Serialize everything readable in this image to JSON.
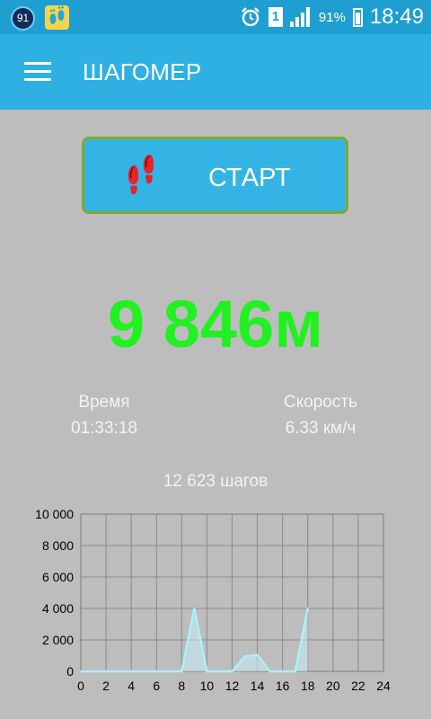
{
  "status_bar": {
    "notification_badge": "91",
    "sim_slot": "1",
    "battery_percent": "91%",
    "time": "18:49",
    "icons": [
      "notification-badge-icon",
      "pedometer-app-icon",
      "alarm-icon",
      "sim-icon",
      "signal-icon",
      "battery-icon"
    ]
  },
  "app_bar": {
    "title": "ШАГОМЕР",
    "menu_icon": "hamburger-menu-icon"
  },
  "start_button": {
    "label": "СТАРТ",
    "icon": "footprints-icon"
  },
  "distance": "9 846м",
  "stats": {
    "time_label": "Время",
    "time_value": "01:33:18",
    "speed_label": "Скорость",
    "speed_value": "6.33 км/ч"
  },
  "steps": "12 623 шагов",
  "colors": {
    "app_bar": "#2fb0e3",
    "status_bar": "#1f9fd1",
    "background": "#bdbdbd",
    "distance": "#21f121",
    "start_border": "#7faa2f",
    "chart_line": "#aaf0fb"
  },
  "chart_data": {
    "type": "area",
    "x": [
      0,
      1,
      2,
      3,
      4,
      5,
      6,
      7,
      8,
      9,
      10,
      11,
      12,
      13,
      14,
      15,
      16,
      17,
      18
    ],
    "series": [
      {
        "values": [
          0,
          0,
          0,
          0,
          0,
          0,
          0,
          0,
          0,
          4000,
          0,
          0,
          0,
          950,
          1050,
          0,
          0,
          0,
          4000
        ]
      }
    ],
    "xlim": [
      0,
      24
    ],
    "ylim": [
      0,
      10000
    ],
    "x_ticks": [
      "0",
      "2",
      "4",
      "6",
      "8",
      "10",
      "12",
      "14",
      "16",
      "18",
      "20",
      "22",
      "24"
    ],
    "y_ticks": [
      "0",
      "2 000",
      "4 000",
      "6 000",
      "8 000",
      "10 000"
    ],
    "grid": true
  }
}
